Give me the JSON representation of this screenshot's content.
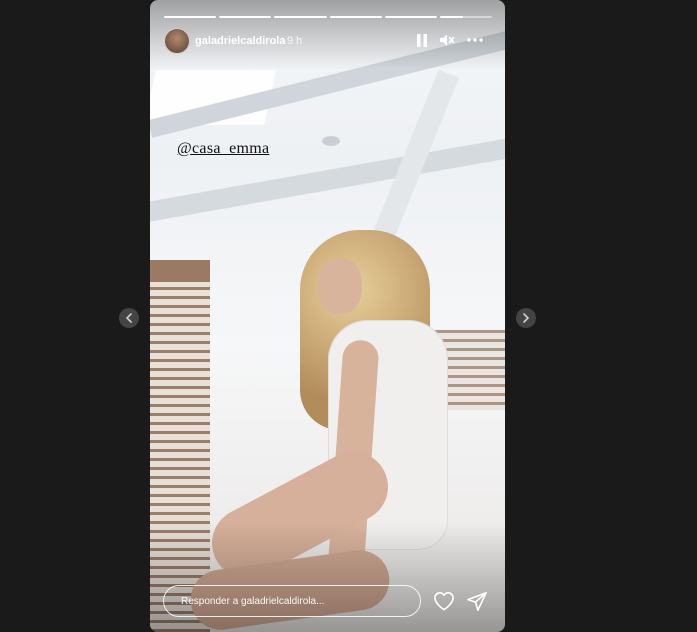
{
  "story": {
    "username": "galadrielcaldirola",
    "time": "9 h",
    "segments": [
      1,
      1,
      1,
      1,
      1,
      0.45
    ],
    "mention": "@casa_emma",
    "reply_placeholder": "Responder a galadrielcaldirola..."
  },
  "icons": {
    "pause": "pause-icon",
    "mute": "muted-speaker-icon",
    "more": "more-dots-icon",
    "prev": "chevron-left-icon",
    "next": "chevron-right-icon",
    "like": "heart-icon",
    "share": "paper-plane-icon"
  },
  "colors": {
    "background": "#1a1a1a",
    "nav": "#444444"
  }
}
